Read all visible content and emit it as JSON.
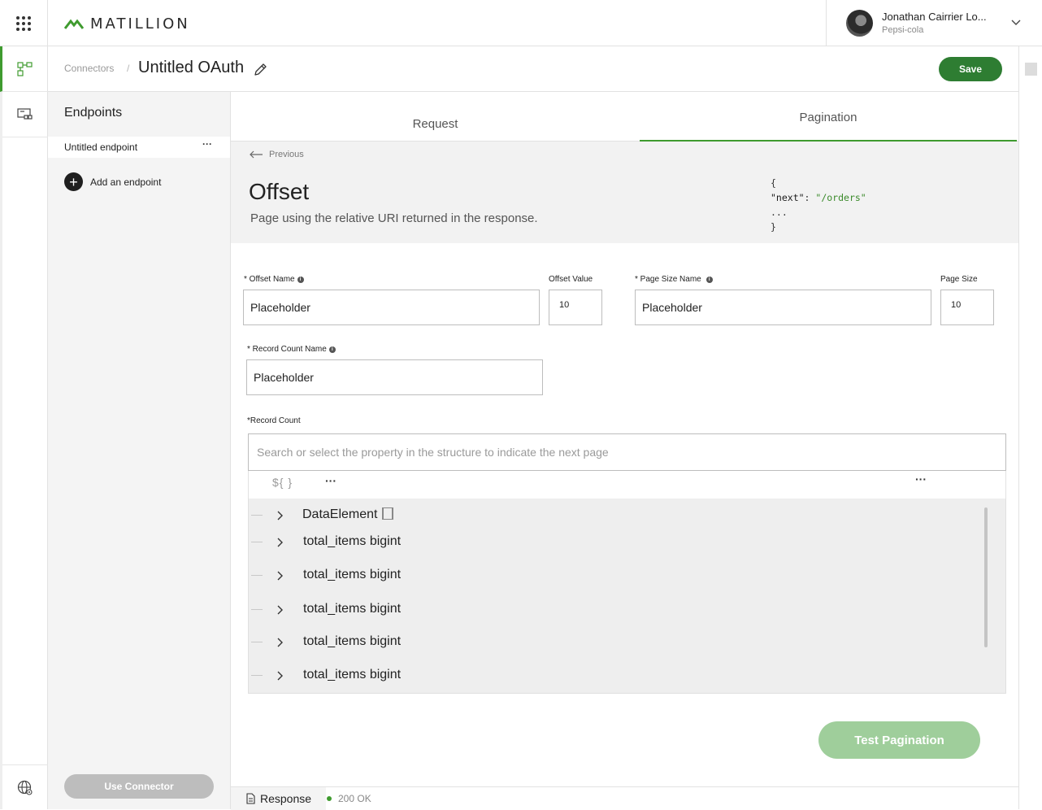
{
  "brand": {
    "logo_text": "MATILLION",
    "accent": "#3f9b2f",
    "button_green": "#2e7d32",
    "button_disabled_green": "#9fce9b"
  },
  "user": {
    "name": "Jonathan Cairrier Lo...",
    "org": "Pepsi-cola"
  },
  "rail": {
    "items": [
      "connectors-icon",
      "jobs-icon",
      "globe-icon"
    ]
  },
  "breadcrumb": {
    "parent": "Connectors",
    "separator": "/",
    "title": "Untitled OAuth"
  },
  "toolbar": {
    "save_label": "Save"
  },
  "endpoints": {
    "title": "Endpoints",
    "items": [
      {
        "label": "Untitled endpoint",
        "more": "···"
      }
    ],
    "add_label": "Add an endpoint",
    "use_connector_label": "Use Connector"
  },
  "tabs": [
    {
      "label": "Request"
    },
    {
      "label": "Pagination",
      "active": true
    }
  ],
  "pagination": {
    "previous_label": "Previous",
    "title": "Offset",
    "description": "Page using the relative URI returned in the response.",
    "code": {
      "open": "{",
      "key": "\"next\"",
      "colon": ": ",
      "value": "\"/orders\"",
      "ellipsis": "...",
      "close": "}"
    }
  },
  "form": {
    "offset_name": {
      "label": "* Offset Name",
      "value": "Placeholder"
    },
    "offset_value": {
      "label": "Offset Value",
      "value": "10"
    },
    "page_size_name": {
      "label": "* Page Size Name",
      "value": "Placeholder"
    },
    "page_size": {
      "label": "Page Size",
      "value": "10"
    },
    "record_count_name": {
      "label": "* Record Count Name",
      "value": "Placeholder"
    },
    "record_count": {
      "label": "*Record Count",
      "placeholder": "Search or select the property in the structure to indicate the next page"
    }
  },
  "tree": {
    "toolbar_symbol": "${ }",
    "more": "···",
    "rows": [
      {
        "label": "DataElement"
      },
      {
        "label": "total_items bigint"
      },
      {
        "label": "total_items bigint"
      },
      {
        "label": "total_items bigint"
      },
      {
        "label": "total_items bigint"
      },
      {
        "label": "total_items bigint"
      }
    ]
  },
  "actions": {
    "test_label": "Test Pagination"
  },
  "response": {
    "tab_label": "Response",
    "status": "200 OK"
  }
}
